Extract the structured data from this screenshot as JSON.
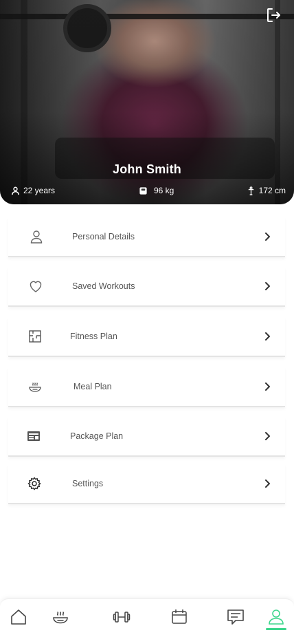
{
  "profile": {
    "name": "John Smith",
    "age": "22 years",
    "weight": "96 kg",
    "height": "172 cm"
  },
  "menu": {
    "items": [
      {
        "label": "Personal Details",
        "icon": "user-icon"
      },
      {
        "label": "Saved Workouts",
        "icon": "heart-icon"
      },
      {
        "label": "Fitness Plan",
        "icon": "floor-plan-icon"
      },
      {
        "label": "Meal Plan",
        "icon": "bowl-icon"
      },
      {
        "label": "Package Plan",
        "icon": "package-list-icon"
      },
      {
        "label": "Settings",
        "icon": "gear-icon"
      }
    ]
  },
  "nav": {
    "items": [
      "home-icon",
      "bowl-icon",
      "dumbbell-icon",
      "calendar-icon",
      "chat-icon",
      "profile-icon"
    ],
    "active": "profile-icon",
    "active_color": "#3dd68c"
  }
}
